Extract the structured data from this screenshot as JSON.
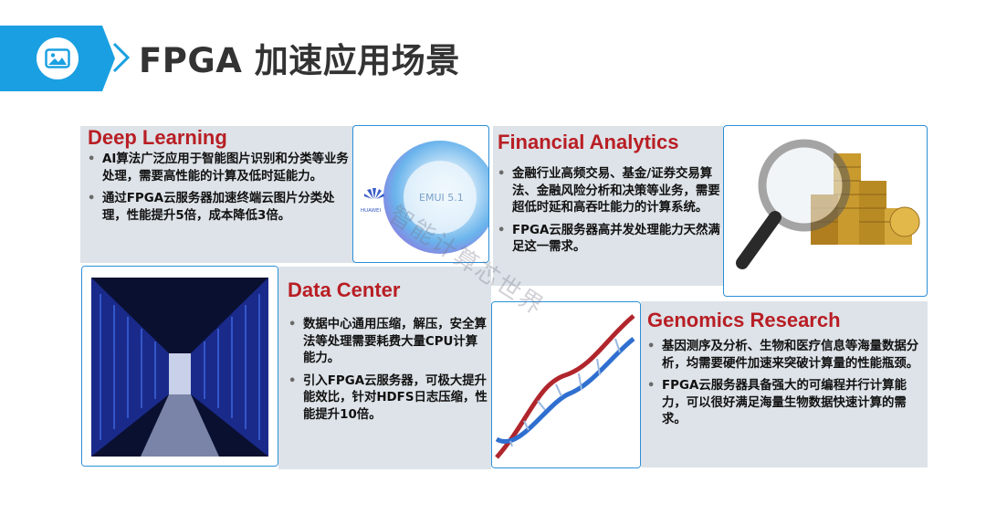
{
  "header": {
    "title": "FPGA 加速应用场景",
    "icon": "image-icon",
    "accent_color": "#1aa0e2"
  },
  "panels": {
    "deep_learning": {
      "title": "Deep Learning",
      "bullets": [
        "AI算法广泛应用于智能图片识别和分类等业务处理，需要高性能的计算及低时延能力。",
        "通过FPGA云服务器加速终端云图片分类处理，性能提升5倍，成本降低3倍。"
      ],
      "image": {
        "brand": "HUAWEI",
        "os_label": "EMUI 5.1"
      }
    },
    "financial_analytics": {
      "title": "Financial Analytics",
      "bullets": [
        "金融行业高频交易、基金/证券交易算法、金融风险分析和决策等业务，需要超低时延和高吞吐能力的计算系统。",
        "FPGA云服务器高并发处理能力天然满足这一需求。"
      ],
      "image": "magnifier-coins"
    },
    "data_center": {
      "title": "Data Center",
      "bullets": [
        "数据中心通用压缩，解压，安全算法等处理需要耗费大量CPU计算能力。",
        "引入FPGA云服务器，可极大提升能效比，针对HDFS日志压缩，性能提升10倍。"
      ],
      "image": "server-aisle"
    },
    "genomics_research": {
      "title": "Genomics Research",
      "bullets": [
        "基因测序及分析、生物和医疗信息等海量数据分析，均需要硬件加速来突破计算量的性能瓶颈。",
        "FPGA云服务器具备强大的可编程并行计算能力，可以很好满足海量生物数据快速计算的需求。"
      ],
      "image": "dna-helix"
    }
  },
  "watermark": "智能计算芯世界",
  "colors": {
    "panel_bg": "#dde3e8",
    "title_red": "#b81e24",
    "image_border": "#2a8fd8"
  }
}
